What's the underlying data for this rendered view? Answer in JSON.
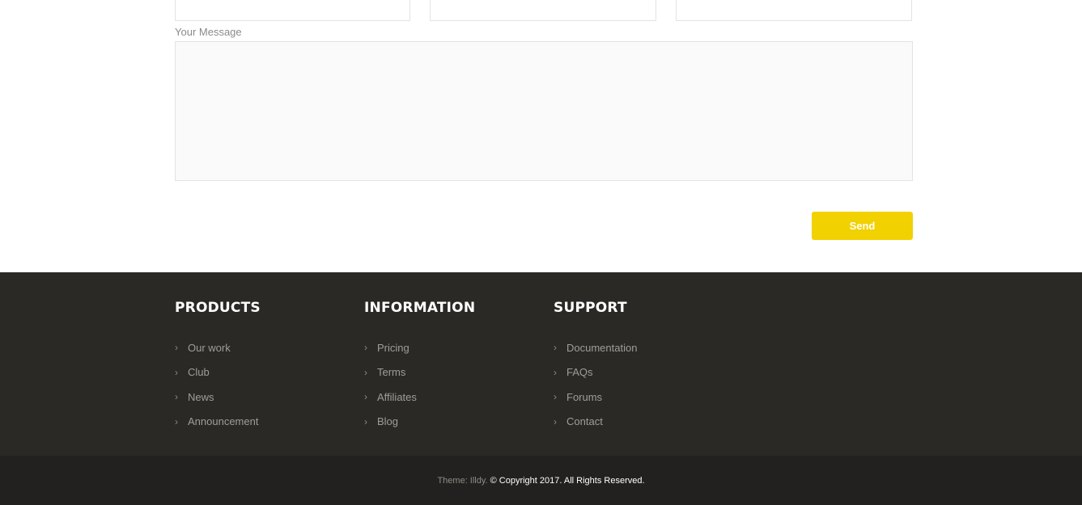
{
  "contact_form": {
    "message_label": "Your Message",
    "message_value": "",
    "send_label": "Send"
  },
  "footer": {
    "columns": [
      {
        "title": "PRODUCTS",
        "links": [
          "Our work",
          "Club",
          "News",
          "Announcement"
        ]
      },
      {
        "title": "INFORMATION",
        "links": [
          "Pricing",
          "Terms",
          "Affiliates",
          "Blog"
        ]
      },
      {
        "title": "SUPPORT",
        "links": [
          "Documentation",
          "FAQs",
          "Forums",
          "Contact"
        ]
      }
    ],
    "theme_credit": "Theme: Illdy.",
    "copyright": "© Copyright 2017. All Rights Reserved."
  },
  "colors": {
    "accent": "#f2d100",
    "footer_bg": "#2b2926",
    "bottom_bar_bg": "#23211f"
  },
  "icons": {
    "link_bullet": "chevron-right-icon"
  }
}
